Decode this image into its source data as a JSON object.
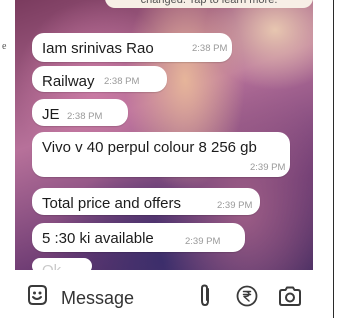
{
  "banner": {
    "text": "changed. Tap to learn more."
  },
  "page_margin": {
    "left_text": "e"
  },
  "messages": [
    {
      "text": "Iam srinivas Rao",
      "time": "2:38 PM"
    },
    {
      "text": "Railway",
      "time": "2:38 PM"
    },
    {
      "text": "JE",
      "time": "2:38 PM"
    },
    {
      "text": "Vivo v 40 perpul colour 8 256 gb",
      "time": "2:39 PM"
    },
    {
      "text": "Total price and offers",
      "time": "2:39 PM"
    },
    {
      "text": "5 :30 ki available",
      "time": "2:39 PM"
    },
    {
      "text": "Ok",
      "time": ""
    }
  ],
  "input": {
    "placeholder": "Message",
    "icons": [
      "emoji-icon",
      "attach-icon",
      "rupee-icon",
      "camera-icon"
    ]
  },
  "colors": {
    "bubble": "#ffffff",
    "timestamp": "#9a9a9a",
    "icon": "#3a3a3a"
  }
}
